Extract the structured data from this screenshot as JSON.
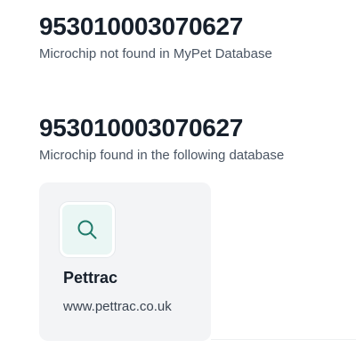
{
  "results": [
    {
      "chip_number": "953010003070627",
      "status": "Microchip not found in MyPet Database"
    },
    {
      "chip_number": "953010003070627",
      "status": "Microchip found in the following database"
    }
  ],
  "database_card": {
    "icon": "search-icon",
    "name": "Pettrac",
    "url": "www.pettrac.co.uk"
  },
  "colors": {
    "icon_stroke": "#1f7a6a",
    "icon_background": "#eaf6f4",
    "card_background": "#f3f4f6"
  }
}
